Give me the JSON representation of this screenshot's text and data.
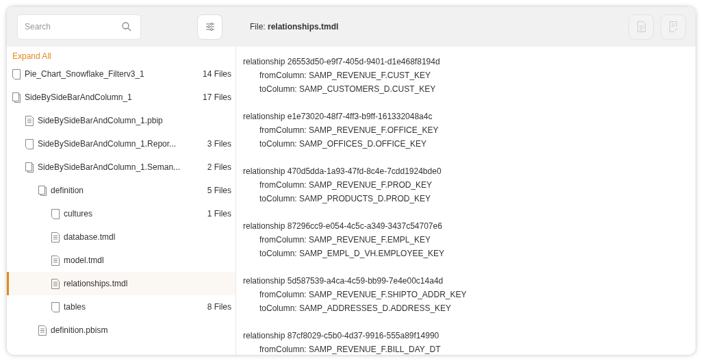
{
  "search": {
    "placeholder": "Search"
  },
  "file": {
    "label": "File:",
    "name": "relationships.tmdl"
  },
  "actions": [
    {
      "kind": "checklist",
      "disabled": true
    },
    {
      "kind": "edit",
      "disabled": true
    }
  ],
  "expand_all": "Expand All",
  "tree": [
    {
      "kind": "blank",
      "label": "Pie_Chart_Snowflake_Filterv3_1",
      "count": "14 Files",
      "selected": false
    },
    {
      "kind": "book",
      "label": "SideBySideBarAndColumn_1",
      "count": "17 Files",
      "selected": false,
      "children": [
        {
          "kind": "text",
          "label": "SideBySideBarAndColumn_1.pbip",
          "selected": false
        },
        {
          "kind": "blank",
          "label": "SideBySideBarAndColumn_1.Repor...",
          "count": "3 Files",
          "selected": false
        },
        {
          "kind": "book",
          "label": "SideBySideBarAndColumn_1.Seman...",
          "count": "2 Files",
          "selected": false,
          "children": [
            {
              "kind": "book",
              "label": "definition",
              "count": "5 Files",
              "selected": false,
              "children": [
                {
                  "kind": "blank",
                  "label": "cultures",
                  "count": "1 Files",
                  "selected": false
                },
                {
                  "kind": "text",
                  "label": "database.tmdl",
                  "selected": false
                },
                {
                  "kind": "text",
                  "label": "model.tmdl",
                  "selected": false
                },
                {
                  "kind": "text",
                  "label": "relationships.tmdl",
                  "selected": true
                },
                {
                  "kind": "blank",
                  "label": "tables",
                  "count": "8 Files",
                  "selected": false
                }
              ]
            },
            {
              "kind": "text",
              "label": "definition.pbism",
              "selected": false
            }
          ]
        }
      ]
    }
  ],
  "relationships": [
    {
      "header": "relationship 26553d50-e9f7-405d-9401-d1e468f8194d",
      "from": "fromColumn: SAMP_REVENUE_F.CUST_KEY",
      "to": "toColumn: SAMP_CUSTOMERS_D.CUST_KEY"
    },
    {
      "header": "relationship e1e73020-48f7-4ff3-b9ff-161332048a4c",
      "from": "fromColumn: SAMP_REVENUE_F.OFFICE_KEY",
      "to": "toColumn: SAMP_OFFICES_D.OFFICE_KEY"
    },
    {
      "header": "relationship 470d5dda-1a93-47fd-8c4e-7cdd1924bde0",
      "from": "fromColumn: SAMP_REVENUE_F.PROD_KEY",
      "to": "toColumn: SAMP_PRODUCTS_D.PROD_KEY"
    },
    {
      "header": "relationship 87296cc9-e054-4c5c-a349-3437c54707e6",
      "from": "fromColumn: SAMP_REVENUE_F.EMPL_KEY",
      "to": "toColumn: SAMP_EMPL_D_VH.EMPLOYEE_KEY"
    },
    {
      "header": "relationship 5d587539-a4ca-4c59-bb99-7e4e00c14a4d",
      "from": "fromColumn: SAMP_REVENUE_F.SHIPTO_ADDR_KEY",
      "to": "toColumn: SAMP_ADDRESSES_D.ADDRESS_KEY"
    },
    {
      "header": "relationship 87cf8029-c5b0-4d37-9916-555a89f14990",
      "from": "fromColumn: SAMP_REVENUE_F.BILL_DAY_DT"
    }
  ]
}
